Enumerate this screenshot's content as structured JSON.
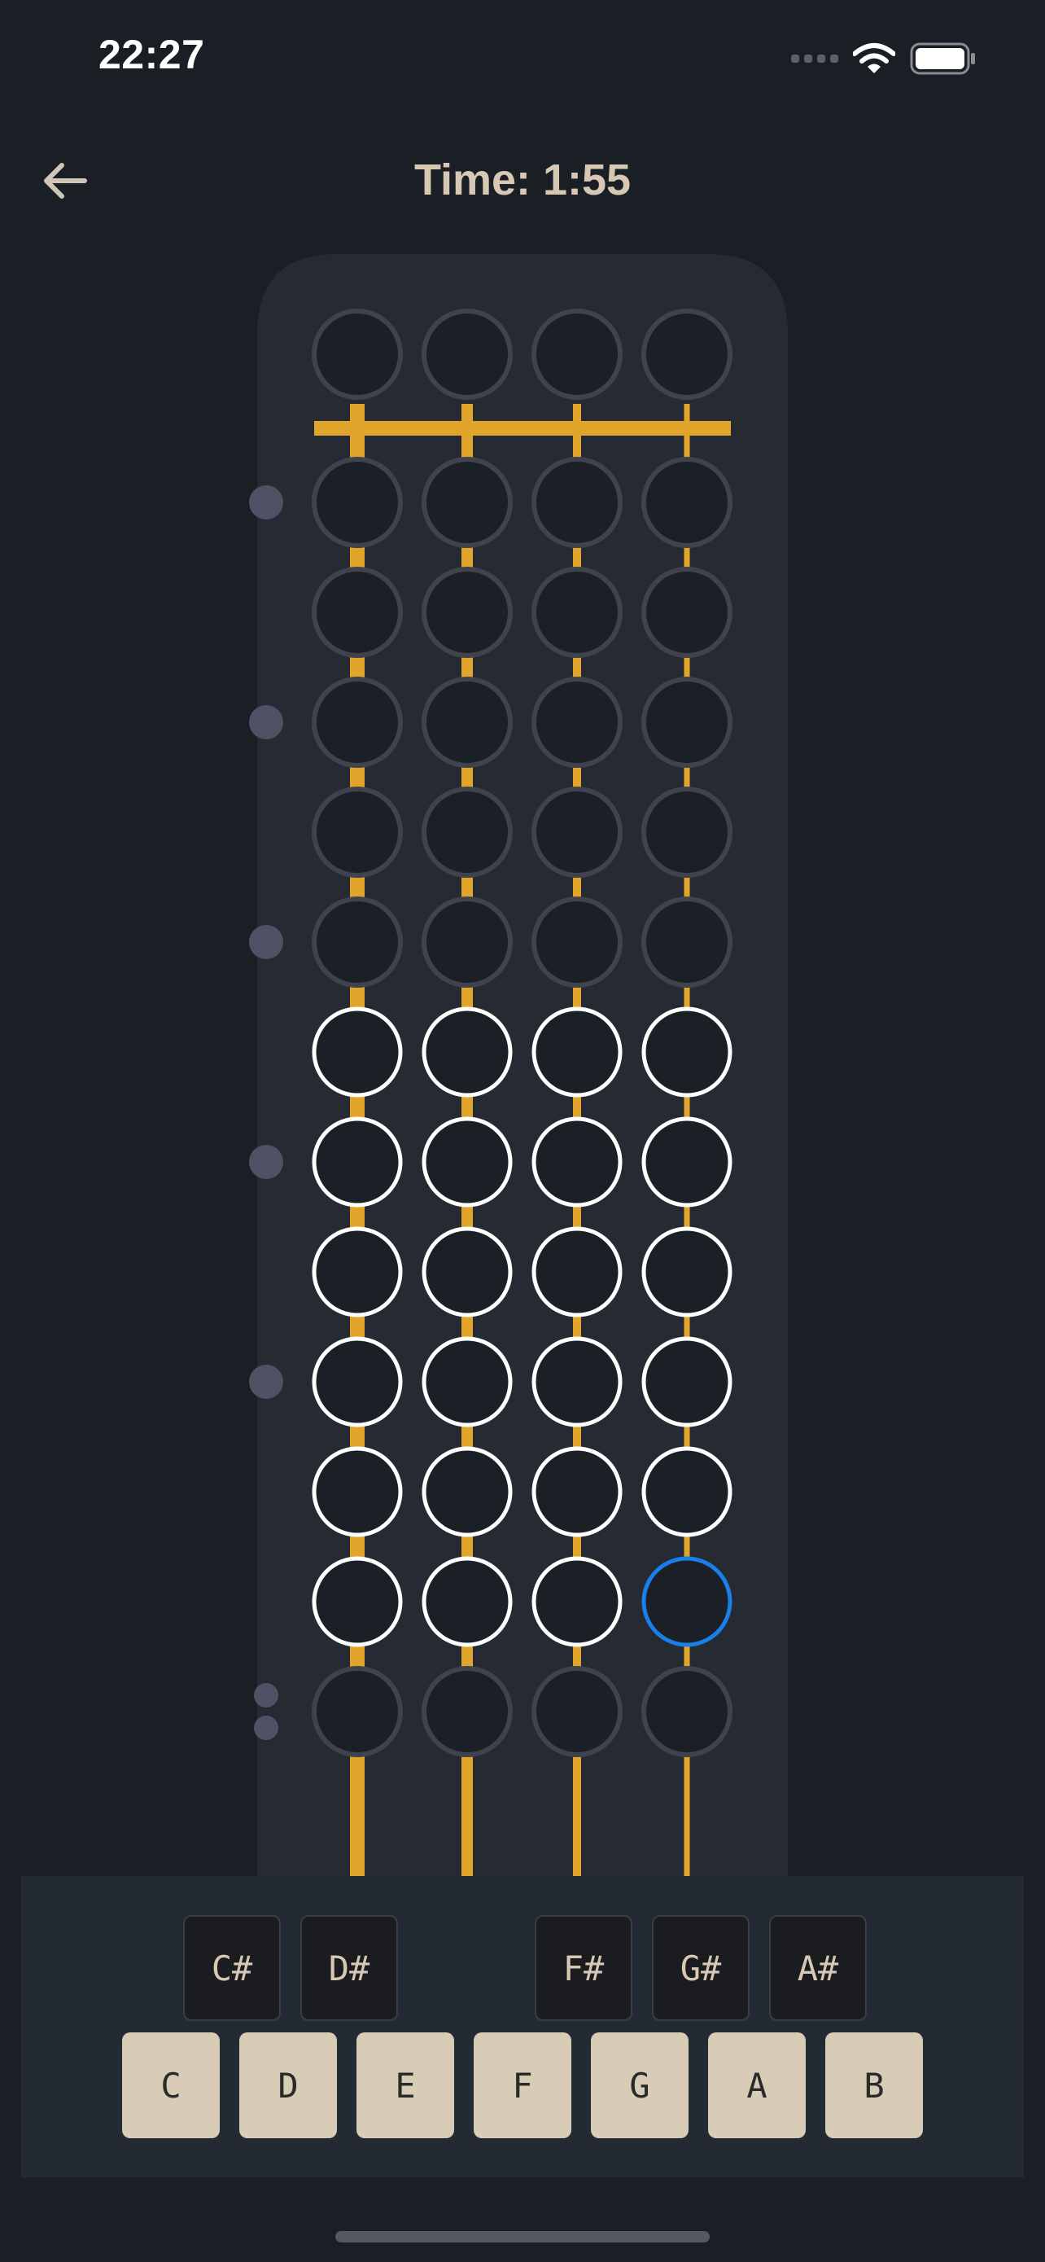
{
  "status_bar": {
    "time": "22:27",
    "signal_icon": "cellular-dots-icon",
    "wifi_icon": "wifi-icon",
    "battery_icon": "battery-full-icon"
  },
  "header": {
    "back_icon": "arrow-left-icon",
    "title": "Time: 1:55"
  },
  "fretboard": {
    "strings": 4,
    "frets_below_nut": 12,
    "open_row": [
      "open",
      "open",
      "open",
      "open"
    ],
    "fret_rows": [
      [
        "dim",
        "dim",
        "dim",
        "dim"
      ],
      [
        "dim",
        "dim",
        "dim",
        "dim"
      ],
      [
        "dim",
        "dim",
        "dim",
        "dim"
      ],
      [
        "dim",
        "dim",
        "dim",
        "dim"
      ],
      [
        "dim",
        "dim",
        "dim",
        "dim"
      ],
      [
        "lit",
        "lit",
        "lit",
        "lit"
      ],
      [
        "lit",
        "lit",
        "lit",
        "lit"
      ],
      [
        "lit",
        "lit",
        "lit",
        "lit"
      ],
      [
        "lit",
        "lit",
        "lit",
        "lit"
      ],
      [
        "lit",
        "lit",
        "lit",
        "lit"
      ],
      [
        "lit",
        "lit",
        "lit",
        "selected"
      ],
      [
        "dim",
        "dim",
        "dim",
        "dim"
      ]
    ],
    "inlay_dots": [
      {
        "fret": 1,
        "count": 1
      },
      {
        "fret": 3,
        "count": 1
      },
      {
        "fret": 5,
        "count": 1
      },
      {
        "fret": 7,
        "count": 1
      },
      {
        "fret": 9,
        "count": 1
      },
      {
        "fret": 12,
        "count": 2
      }
    ],
    "colors": {
      "string": "#e0a52a",
      "panel": "#262b33",
      "dim_ring": "#3f434e",
      "lit_ring": "#ffffff",
      "selected_ring": "#1a7fe8",
      "inlay": "#4f5264"
    }
  },
  "keyboard": {
    "black_keys": [
      "C#",
      "D#",
      "F#",
      "G#",
      "A#"
    ],
    "white_keys": [
      "C",
      "D",
      "E",
      "F",
      "G",
      "A",
      "B"
    ]
  }
}
